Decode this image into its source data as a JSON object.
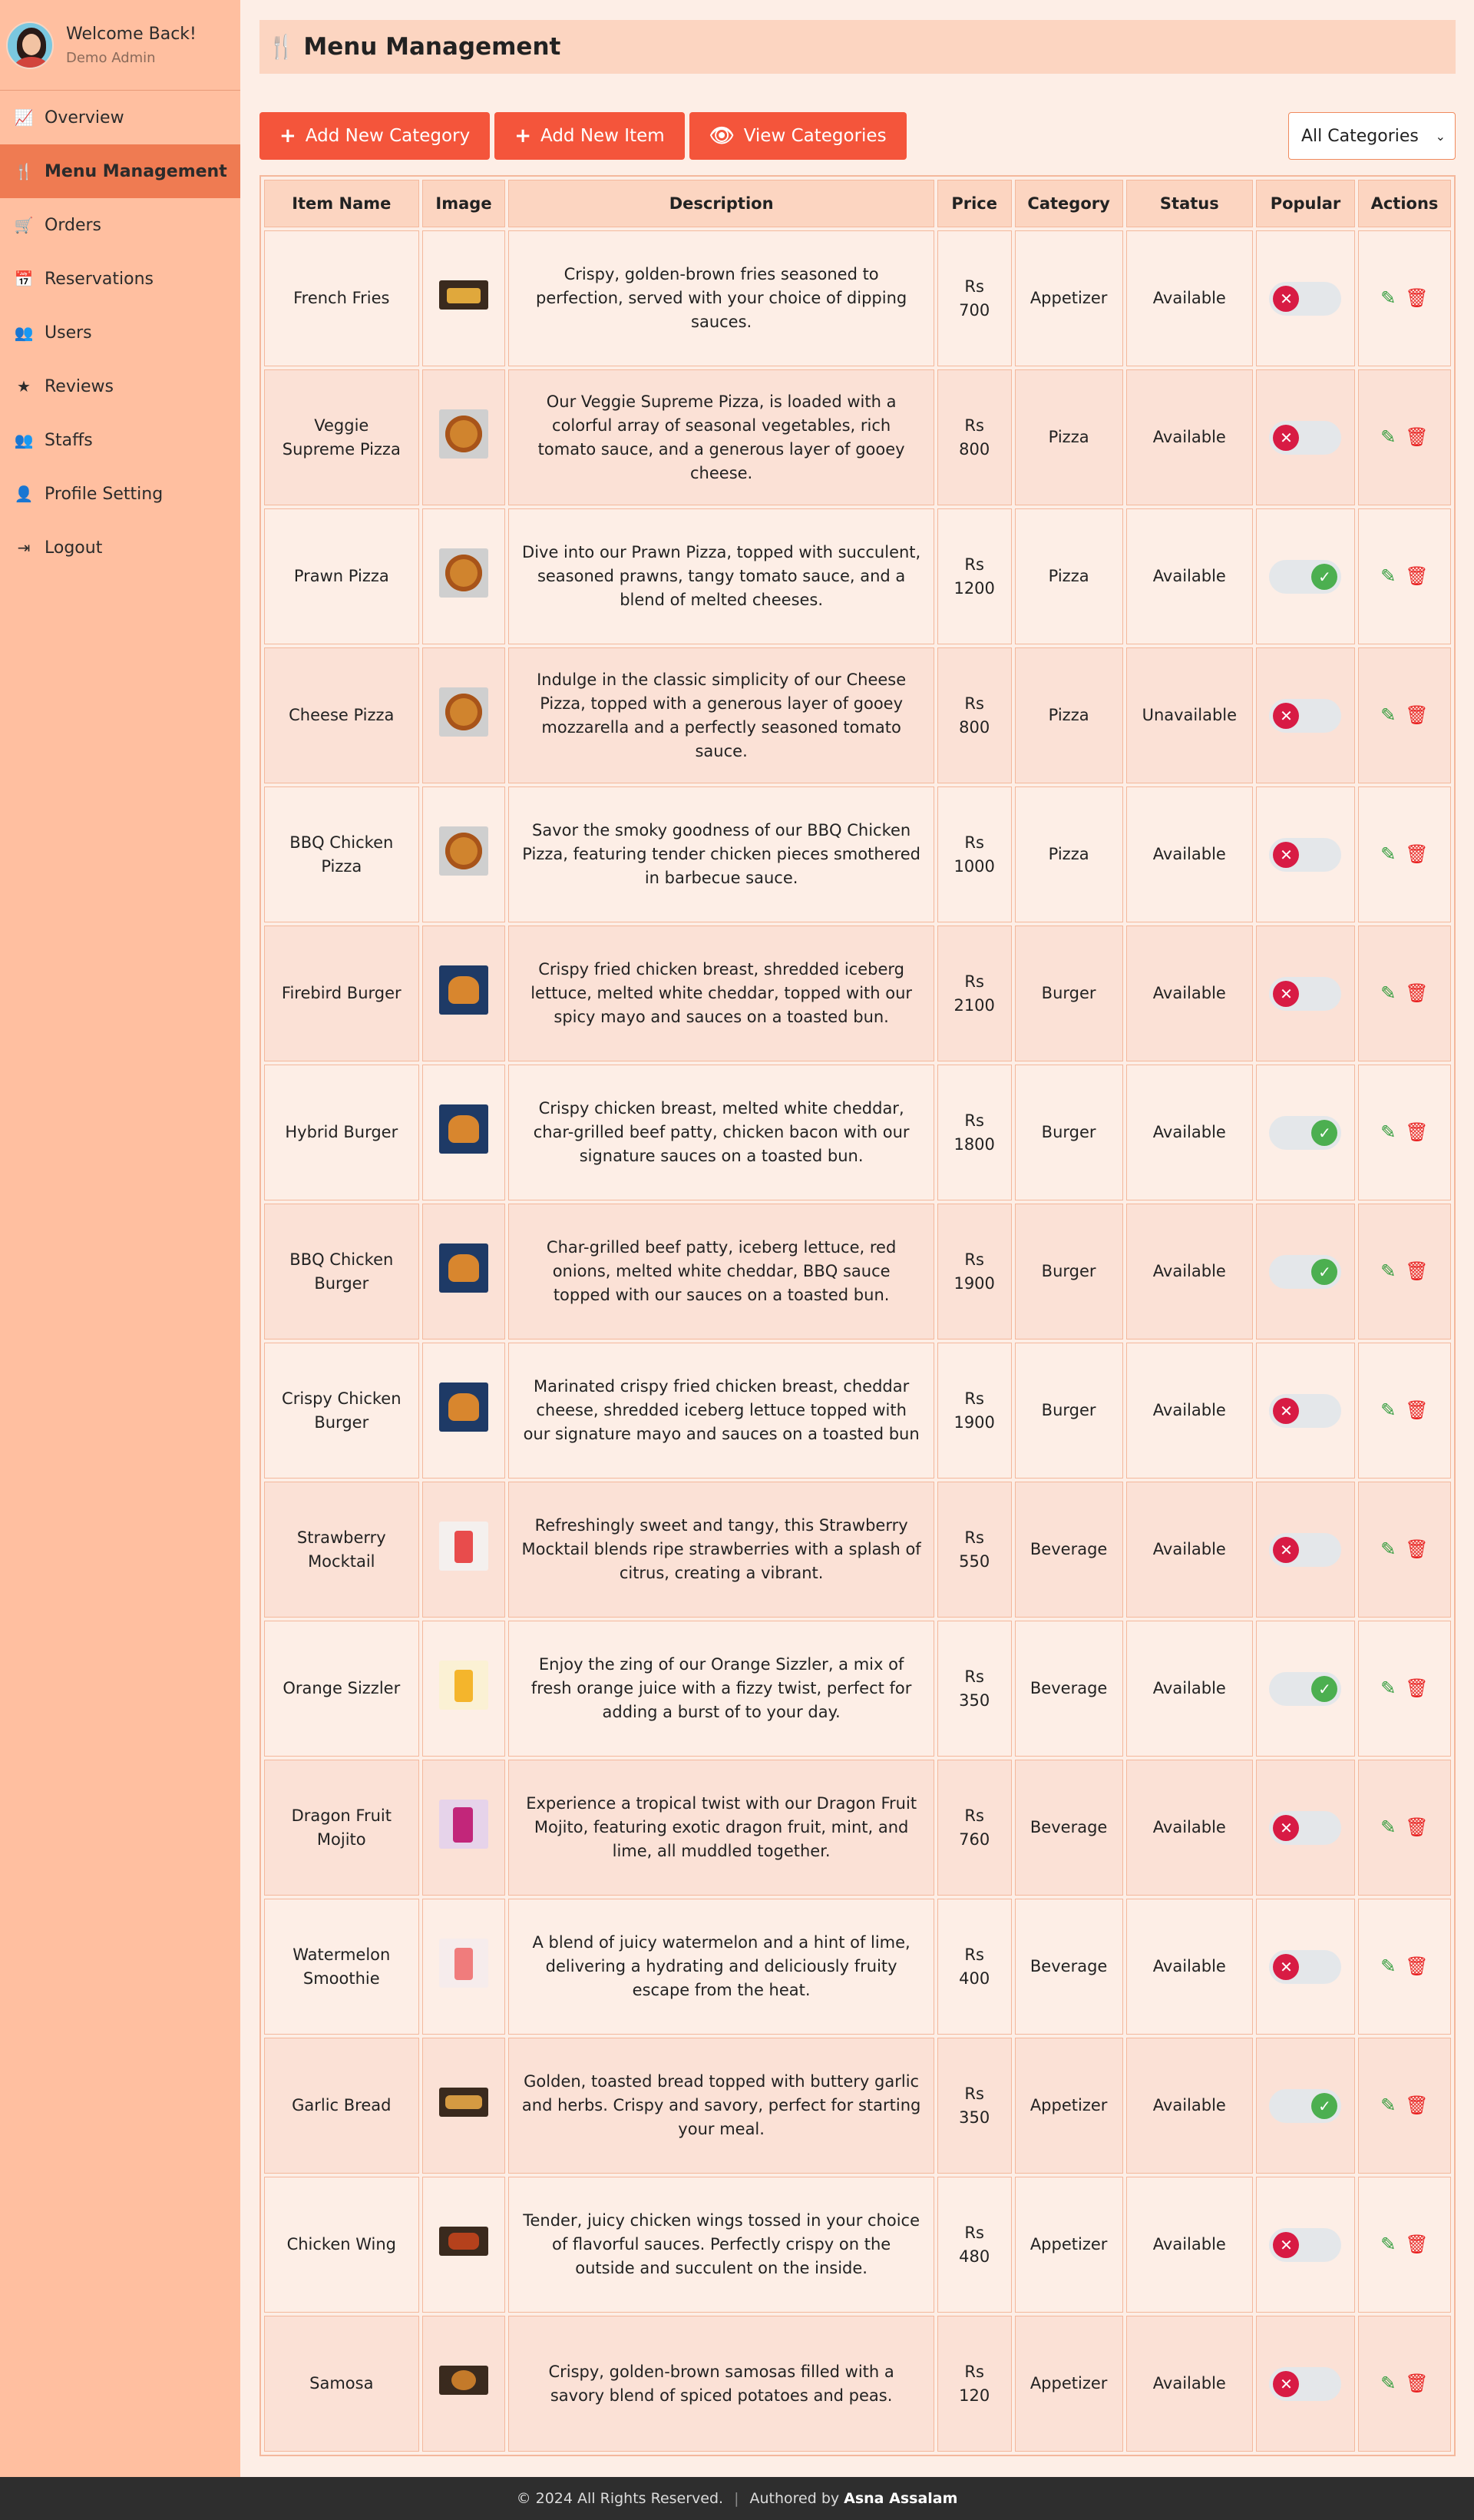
{
  "sidebar": {
    "welcome": "Welcome Back!",
    "role": "Demo Admin",
    "items": [
      {
        "label": "Overview",
        "icon": "chart-line-icon",
        "active": false
      },
      {
        "label": "Menu Management",
        "icon": "utensils-icon",
        "active": true
      },
      {
        "label": "Orders",
        "icon": "cart-icon",
        "active": false
      },
      {
        "label": "Reservations",
        "icon": "calendar-icon",
        "active": false
      },
      {
        "label": "Users",
        "icon": "users-icon",
        "active": false
      },
      {
        "label": "Reviews",
        "icon": "star-icon",
        "active": false
      },
      {
        "label": "Staffs",
        "icon": "staff-icon",
        "active": false
      },
      {
        "label": "Profile Setting",
        "icon": "user-icon",
        "active": false
      },
      {
        "label": "Logout",
        "icon": "logout-icon",
        "active": false
      }
    ]
  },
  "header": {
    "title": "Menu Management"
  },
  "toolbar": {
    "add_category": "Add New Category",
    "add_item": "Add New Item",
    "view_categories": "View Categories",
    "filter_value": "All Categories"
  },
  "table": {
    "columns": [
      "Item Name",
      "Image",
      "Description",
      "Price",
      "Category",
      "Status",
      "Popular",
      "Actions"
    ],
    "rows": [
      {
        "name": "French Fries",
        "img": "fries",
        "desc": "Crispy, golden-brown fries seasoned to perfection, served with your choice of dipping sauces.",
        "cur": "Rs",
        "price": "700",
        "category": "Appetizer",
        "status": "Available",
        "popular": false
      },
      {
        "name": "Veggie Supreme Pizza",
        "img": "round",
        "desc": "Our Veggie Supreme Pizza, is loaded with a colorful array of seasonal vegetables, rich tomato sauce, and a generous layer of gooey cheese.",
        "cur": "Rs",
        "price": "800",
        "category": "Pizza",
        "status": "Available",
        "popular": false
      },
      {
        "name": "Prawn Pizza",
        "img": "round",
        "desc": "Dive into our Prawn Pizza, topped with succulent, seasoned prawns, tangy tomato sauce, and a blend of melted cheeses.",
        "cur": "Rs",
        "price": "1200",
        "category": "Pizza",
        "status": "Available",
        "popular": true
      },
      {
        "name": "Cheese Pizza",
        "img": "round",
        "desc": "Indulge in the classic simplicity of our Cheese Pizza, topped with a generous layer of gooey mozzarella and a perfectly seasoned tomato sauce.",
        "cur": "Rs",
        "price": "800",
        "category": "Pizza",
        "status": "Unavailable",
        "popular": false
      },
      {
        "name": "BBQ Chicken Pizza",
        "img": "round",
        "desc": "Savor the smoky goodness of our BBQ Chicken Pizza, featuring tender chicken pieces smothered in barbecue sauce.",
        "cur": "Rs",
        "price": "1000",
        "category": "Pizza",
        "status": "Available",
        "popular": false
      },
      {
        "name": "Firebird Burger",
        "img": "burger",
        "desc": "Crispy fried chicken breast, shredded iceberg lettuce, melted white cheddar, topped with our spicy mayo and sauces on a toasted bun.",
        "cur": "Rs",
        "price": "2100",
        "category": "Burger",
        "status": "Available",
        "popular": false
      },
      {
        "name": "Hybrid Burger",
        "img": "burger",
        "desc": "Crispy chicken breast, melted white cheddar, char-grilled beef patty, chicken bacon with our signature sauces on a toasted bun.",
        "cur": "Rs",
        "price": "1800",
        "category": "Burger",
        "status": "Available",
        "popular": true
      },
      {
        "name": "BBQ Chicken Burger",
        "img": "burger",
        "desc": "Char-grilled beef patty, iceberg lettuce, red onions, melted white cheddar, BBQ sauce topped with our sauces on a toasted bun.",
        "cur": "Rs",
        "price": "1900",
        "category": "Burger",
        "status": "Available",
        "popular": true
      },
      {
        "name": "Crispy Chicken Burger",
        "img": "burger",
        "desc": "Marinated crispy fried chicken breast, cheddar cheese, shredded iceberg lettuce topped with our signature mayo and sauces on a toasted bun",
        "cur": "Rs",
        "price": "1900",
        "category": "Burger",
        "status": "Available",
        "popular": false
      },
      {
        "name": "Strawberry Mocktail",
        "img": "drink",
        "desc": "Refreshingly sweet and tangy, this Strawberry Mocktail blends ripe strawberries with a splash of citrus, creating a vibrant.",
        "cur": "Rs",
        "price": "550",
        "category": "Beverage",
        "status": "Available",
        "popular": false
      },
      {
        "name": "Orange Sizzler",
        "img": "orange",
        "desc": "Enjoy the zing of our Orange Sizzler, a mix of fresh orange juice with a fizzy twist, perfect for adding a burst of to your day.",
        "cur": "Rs",
        "price": "350",
        "category": "Beverage",
        "status": "Available",
        "popular": true
      },
      {
        "name": "Dragon Fruit Mojito",
        "img": "mojito",
        "desc": "Experience a tropical twist with our Dragon Fruit Mojito, featuring exotic dragon fruit, mint, and lime, all muddled together.",
        "cur": "Rs",
        "price": "760",
        "category": "Beverage",
        "status": "Available",
        "popular": false
      },
      {
        "name": "Watermelon Smoothie",
        "img": "melon",
        "desc": "A blend of juicy watermelon and a hint of lime, delivering a hydrating and deliciously fruity escape from the heat.",
        "cur": "Rs",
        "price": "400",
        "category": "Beverage",
        "status": "Available",
        "popular": false
      },
      {
        "name": "Garlic Bread",
        "img": "bread",
        "desc": "Golden, toasted bread topped with buttery garlic and herbs. Crispy and savory, perfect for starting your meal.",
        "cur": "Rs",
        "price": "350",
        "category": "Appetizer",
        "status": "Available",
        "popular": true
      },
      {
        "name": "Chicken Wing",
        "img": "wing",
        "desc": "Tender, juicy chicken wings tossed in your choice of flavorful sauces. Perfectly crispy on the outside and succulent on the inside.",
        "cur": "Rs",
        "price": "480",
        "category": "Appetizer",
        "status": "Available",
        "popular": false
      },
      {
        "name": "Samosa",
        "img": "samosa",
        "desc": "Crispy, golden-brown samosas filled with a savory blend of spiced potatoes and peas.",
        "cur": "Rs",
        "price": "120",
        "category": "Appetizer",
        "status": "Available",
        "popular": false
      }
    ]
  },
  "footer": {
    "copyright": "© 2024 All Rights Reserved.",
    "authored": "Authored by",
    "author": "Asna Assalam"
  },
  "colors": {
    "sidebar_bg": "#ffbfa0",
    "active_nav": "#ef7b52",
    "button": "#f4553b",
    "popular_on": "#4caf50",
    "popular_off": "#d81b44"
  }
}
